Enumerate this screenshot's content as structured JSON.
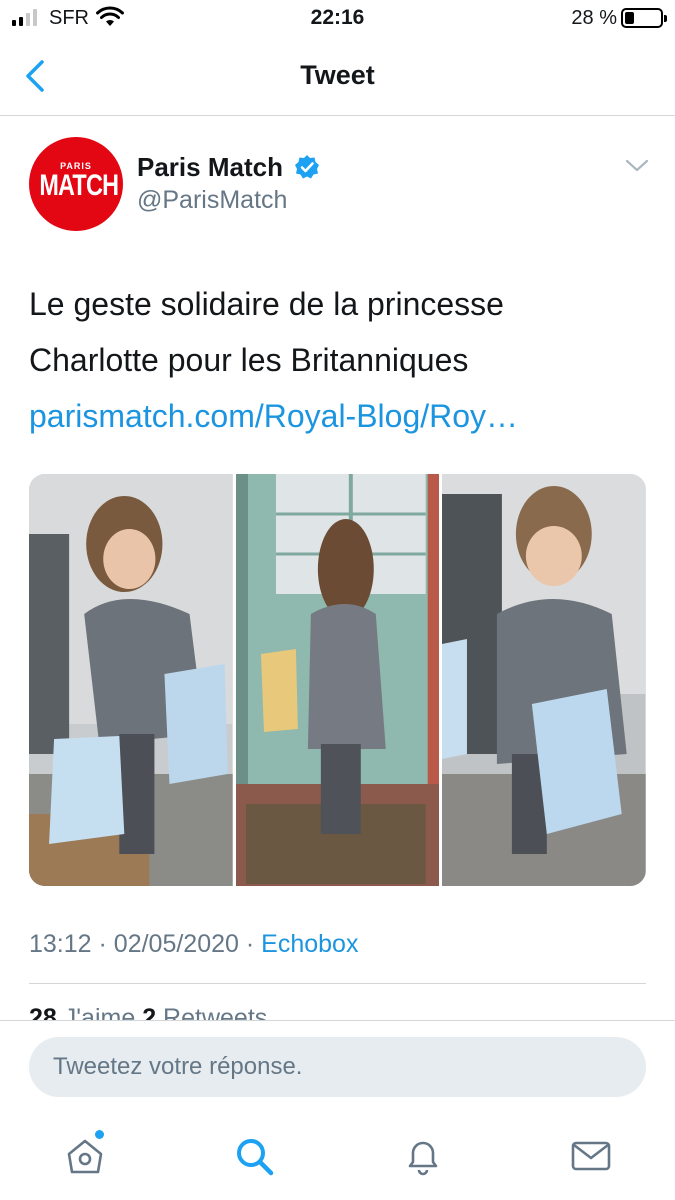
{
  "status_bar": {
    "carrier": "SFR",
    "time": "22:16",
    "battery": "28 %"
  },
  "nav": {
    "title": "Tweet",
    "back_icon": "chevron-left-icon"
  },
  "tweet": {
    "author_name": "Paris Match",
    "handle": "@ParisMatch",
    "avatar_small_text": "PARIS",
    "avatar_big_text": "MATCH",
    "verified_icon": "verified-badge-icon",
    "text_line1": "Le geste solidaire de la princesse",
    "text_line2": "Charlotte pour les Britanniques",
    "link": "parismatch.com/Royal-Blog/Roy…",
    "time": "13:12",
    "date": "02/05/2020",
    "source": "Echobox",
    "separator": "·",
    "likes_count": "28",
    "likes_label": "J'aime",
    "retweets_count": "2",
    "retweets_label": "Retweets"
  },
  "reply": {
    "placeholder": "Tweetez votre réponse."
  },
  "tabbar": {
    "items": [
      "home-icon",
      "search-icon",
      "notifications-icon",
      "messages-icon"
    ]
  },
  "colors": {
    "accent": "#1da1f2",
    "link": "#1b95e0",
    "brand_red": "#e30613",
    "secondary_text": "#657786"
  }
}
